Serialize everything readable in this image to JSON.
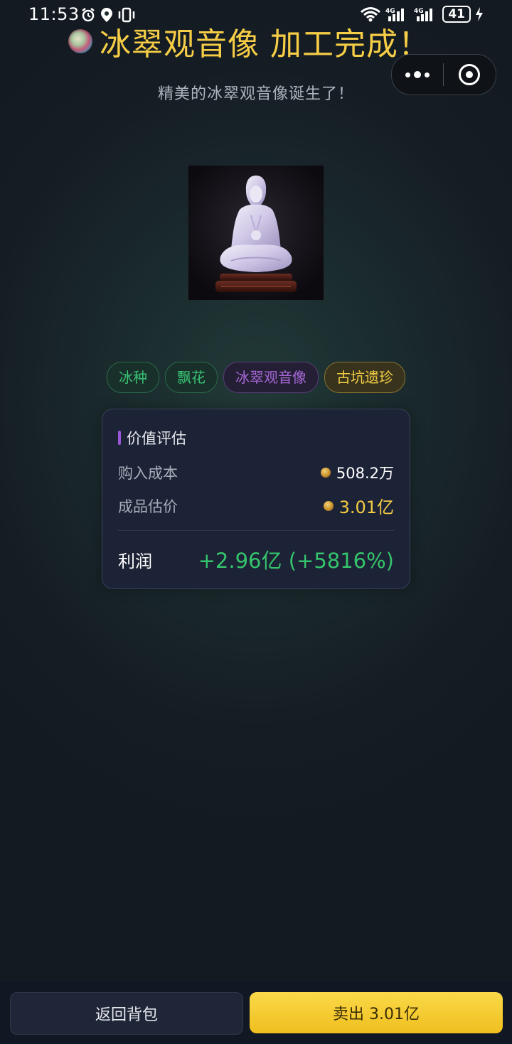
{
  "status_bar": {
    "time": "11:53",
    "battery": "41"
  },
  "header": {
    "title": "冰翠观音像 加工完成！",
    "subtitle": "精美的冰翠观音像诞生了！"
  },
  "tags": [
    {
      "label": "冰种",
      "color": "#38c274"
    },
    {
      "label": "飘花",
      "color": "#38c274"
    },
    {
      "label": "冰翠观音像",
      "color": "#a567d6"
    },
    {
      "label": "古坑遗珍",
      "color": "#f3cc45"
    }
  ],
  "valuation": {
    "title": "价值评估",
    "cost_label": "购入成本",
    "cost_value": "508.2万",
    "estimate_label": "成品估价",
    "estimate_value": "3.01亿",
    "profit_label": "利润",
    "profit_value": "+2.96亿 (+5816%)"
  },
  "actions": {
    "back_label": "返回背包",
    "sell_label": "卖出 3.01亿"
  },
  "colors": {
    "title": "#f6cd46",
    "profit": "#35c46b",
    "sell_button": "#fbd94a"
  }
}
